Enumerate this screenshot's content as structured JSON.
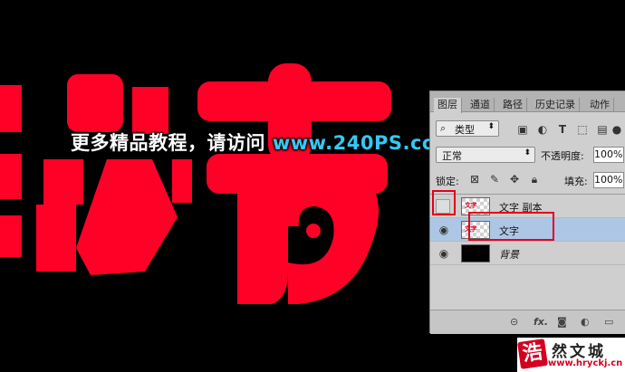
{
  "canvas": {
    "watermark_prefix": "更多精品教程，请访问 ",
    "watermark_url": "www.240PS.com",
    "art_color": "#ff0026"
  },
  "panel": {
    "tabs": [
      "图层",
      "通道",
      "路径",
      "历史记录",
      "动作"
    ],
    "filter": {
      "icon": "search-icon",
      "label": "类型"
    },
    "blend_mode": "正常",
    "opacity_label": "不透明度:",
    "opacity_value": "100%",
    "lock_label": "锁定:",
    "fill_label": "填充:",
    "fill_value": "100%",
    "layers": [
      {
        "name": "文字 副本",
        "visible": false,
        "thumb": "文字"
      },
      {
        "name": "文字",
        "visible": true,
        "thumb": "文字",
        "selected": true
      },
      {
        "name": "背景",
        "visible": true,
        "thumb": ""
      }
    ],
    "bottom_fx": "fx."
  },
  "logo": {
    "char": "浩",
    "name": "然文城",
    "url": "www.hryckj.cn"
  }
}
